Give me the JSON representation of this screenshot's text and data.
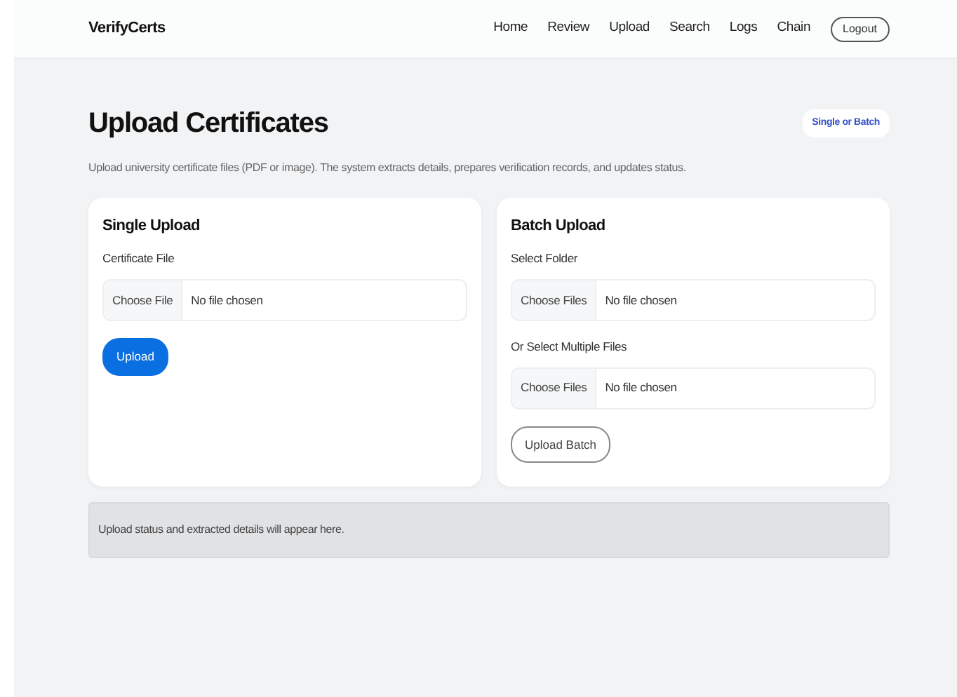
{
  "navbar": {
    "brand": "VerifyCerts",
    "links": [
      "Home",
      "Review",
      "Upload",
      "Search",
      "Logs",
      "Chain"
    ],
    "logout": "Logout"
  },
  "header": {
    "title": "Upload Certificates",
    "badge": "Single or Batch",
    "description": "Upload university certificate files (PDF or image). The system extracts details, prepares verification records, and updates status."
  },
  "panels": [
    {
      "title": "Single Upload",
      "fields": [
        {
          "label": "Certificate File",
          "button": "Choose File",
          "status": "No file chosen"
        }
      ],
      "action": {
        "label": "Upload",
        "kind": "primary"
      }
    },
    {
      "title": "Batch Upload",
      "fields": [
        {
          "label": "Select Folder",
          "button": "Choose Files",
          "status": "No file chosen"
        },
        {
          "label": "Or Select Multiple Files",
          "button": "Choose Files",
          "status": "No file chosen"
        }
      ],
      "action": {
        "label": "Upload Batch",
        "kind": "outline"
      }
    }
  ],
  "status_message": "Upload status and extracted details will appear here."
}
